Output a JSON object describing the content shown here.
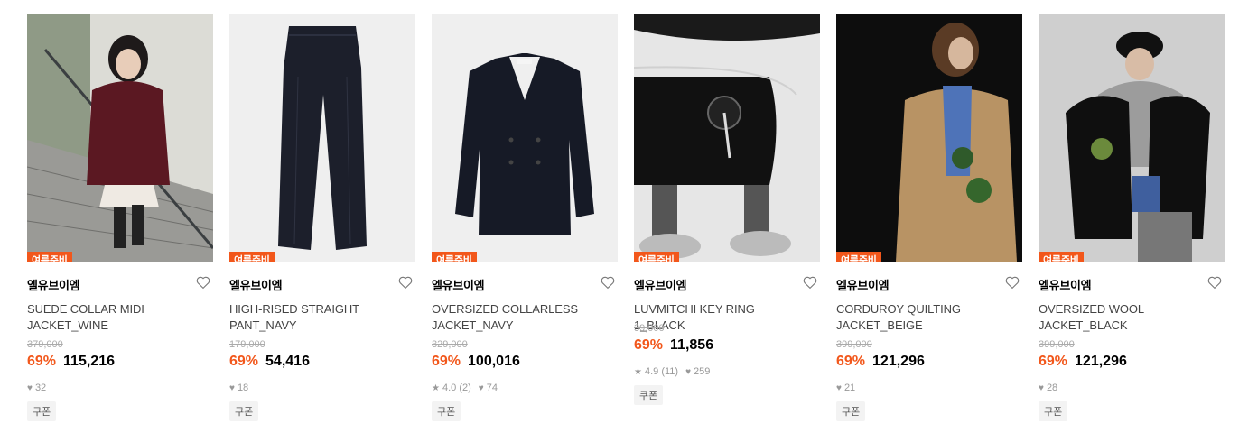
{
  "products": [
    {
      "badge": "여름준비",
      "brand": "엘유브이엠",
      "name_line1": "SUEDE COLLAR MIDI",
      "name_line2": "JACKET_WINE",
      "original_price": "379,000",
      "discount": "69%",
      "price": "115,216",
      "rating": "",
      "reviews": "",
      "likes": "32",
      "coupon": "쿠폰",
      "image": "woman-wine-jacket-on-stairs-photo"
    },
    {
      "badge": "여름준비",
      "brand": "엘유브이엠",
      "name_line1": "HIGH-RISED STRAIGHT",
      "name_line2": "PANT_NAVY",
      "original_price": "179,000",
      "discount": "69%",
      "price": "54,416",
      "rating": "",
      "reviews": "",
      "likes": "18",
      "coupon": "쿠폰",
      "image": "navy-trousers-photo"
    },
    {
      "badge": "여름준비",
      "brand": "엘유브이엠",
      "name_line1": "OVERSIZED COLLARLESS",
      "name_line2": "JACKET_NAVY",
      "original_price": "329,000",
      "discount": "69%",
      "price": "100,016",
      "rating": "4.0",
      "reviews": "(2)",
      "likes": "74",
      "coupon": "쿠폰",
      "image": "navy-collarless-jacket-photo"
    },
    {
      "badge": "여름준비",
      "brand": "엘유브이엠",
      "name_line1": "LUVMITCHI KEY RING 1_BLACK",
      "name_line2": "",
      "original_price": "39,000",
      "discount": "69%",
      "price": "11,856",
      "rating": "4.9",
      "reviews": "(11)",
      "likes": "259",
      "coupon": "쿠폰",
      "image": "black-bag-keyring-photo"
    },
    {
      "badge": "여름준비",
      "brand": "엘유브이엠",
      "name_line1": "CORDUROY QUILTING",
      "name_line2": "JACKET_BEIGE",
      "original_price": "399,000",
      "discount": "69%",
      "price": "121,296",
      "rating": "",
      "reviews": "",
      "likes": "21",
      "coupon": "쿠폰",
      "image": "woman-beige-corduroy-jacket-photo"
    },
    {
      "badge": "여름준비",
      "brand": "엘유브이엠",
      "name_line1": "OVERSIZED WOOL",
      "name_line2": "JACKET_BLACK",
      "original_price": "399,000",
      "discount": "69%",
      "price": "121,296",
      "rating": "",
      "reviews": "",
      "likes": "28",
      "coupon": "쿠폰",
      "image": "woman-black-wool-jacket-photo"
    }
  ],
  "icons": {
    "wishlist": "heart-outline-icon",
    "rating": "star-icon",
    "likes": "heart-filled-icon"
  },
  "colors": {
    "accent": "#f2571b",
    "muted": "#999999",
    "strike": "#aaaaaa",
    "coupon_bg": "#f3f3f3"
  }
}
